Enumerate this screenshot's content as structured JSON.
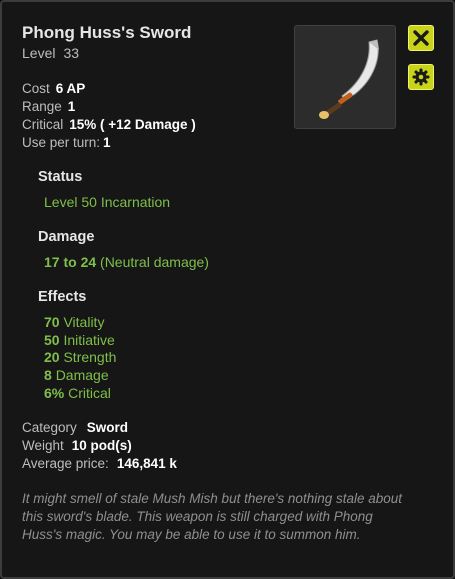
{
  "item": {
    "name": "Phong Huss's Sword",
    "level_label": "Level",
    "level_value": "33",
    "image_icon": "curved-sword-icon"
  },
  "buttons": {
    "close_icon": "close-x-icon",
    "settings_icon": "gear-icon",
    "accent": "#c8d319"
  },
  "stats": [
    {
      "label": "Cost",
      "value": "6 AP"
    },
    {
      "label": "Range",
      "value": "1"
    },
    {
      "label": "Critical",
      "value": "15% ( +12 Damage )"
    },
    {
      "label": "Use per turn:",
      "value": "1"
    }
  ],
  "status": {
    "title": "Status",
    "text": "Level 50 Incarnation"
  },
  "damage": {
    "title": "Damage",
    "range": "17 to 24",
    "type": "(Neutral damage)"
  },
  "effects": {
    "title": "Effects",
    "items": [
      {
        "amount": "70",
        "stat": "Vitality"
      },
      {
        "amount": "50",
        "stat": "Initiative"
      },
      {
        "amount": "20",
        "stat": "Strength"
      },
      {
        "amount": "8",
        "stat": "Damage"
      },
      {
        "amount": "6%",
        "stat": "Critical"
      }
    ]
  },
  "info": [
    {
      "label": "Category",
      "value": "Sword"
    },
    {
      "label": "Weight",
      "value": "10 pod(s)"
    },
    {
      "label": "Average price:",
      "value": "146,841 k"
    }
  ],
  "description": "It might smell of stale Mush Mish but there's nothing stale about this sword's blade. This weapon is still charged with Phong Huss's magic. You may be able to use it to summon him.",
  "colors": {
    "effect_text": "#7fbf4a",
    "background": "#161616"
  }
}
